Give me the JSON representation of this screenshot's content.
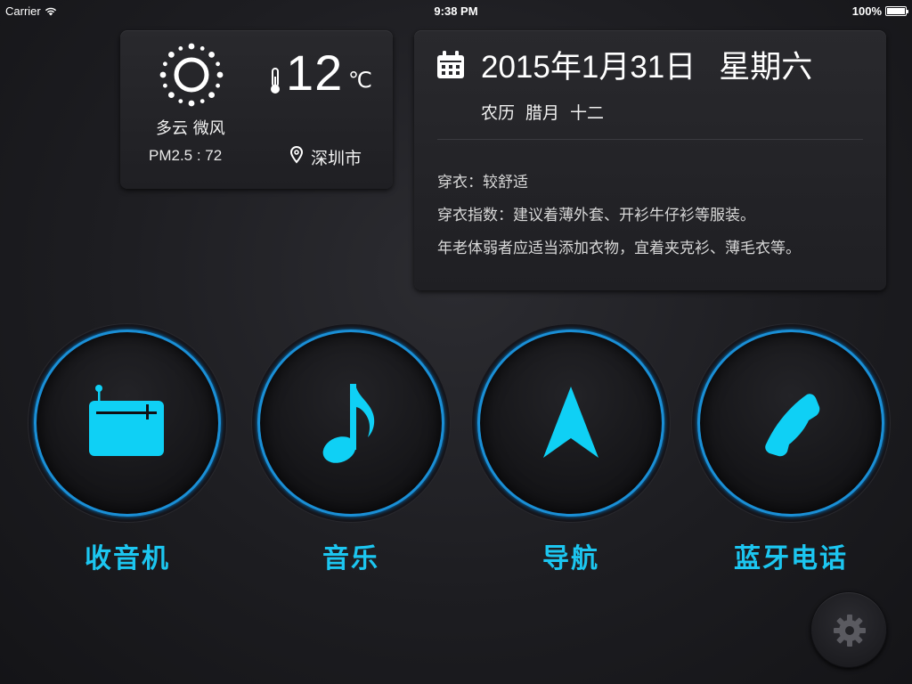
{
  "status_bar": {
    "carrier": "Carrier",
    "time": "9:38 PM",
    "battery": "100%",
    "battery_level": 1.0
  },
  "weather": {
    "icon": "sun-icon",
    "temperature": "12",
    "unit": "℃",
    "condition": "多云 微风",
    "pm25": "PM2.5 : 72",
    "city": "深圳市"
  },
  "date_card": {
    "icon": "calendar-icon",
    "date": "2015年1月31日",
    "weekday": "星期六",
    "lunar": [
      "农历",
      "腊月",
      "十二"
    ],
    "advice": [
      "穿衣：较舒适",
      "穿衣指数：建议着薄外套、开衫牛仔衫等服装。",
      "年老体弱者应适当添加衣物，宜着夹克衫、薄毛衣等。"
    ]
  },
  "functions": [
    {
      "label": "收音机",
      "icon": "radio-icon"
    },
    {
      "label": "音乐",
      "icon": "music-note-icon"
    },
    {
      "label": "导航",
      "icon": "navigation-arrow-icon"
    },
    {
      "label": "蓝牙电话",
      "icon": "phone-icon"
    }
  ],
  "settings": {
    "icon": "gear-icon"
  },
  "colors": {
    "accent": "#1cc6f0",
    "ring": "#1a8fd6",
    "icon_fill": "#0fd0f5"
  }
}
